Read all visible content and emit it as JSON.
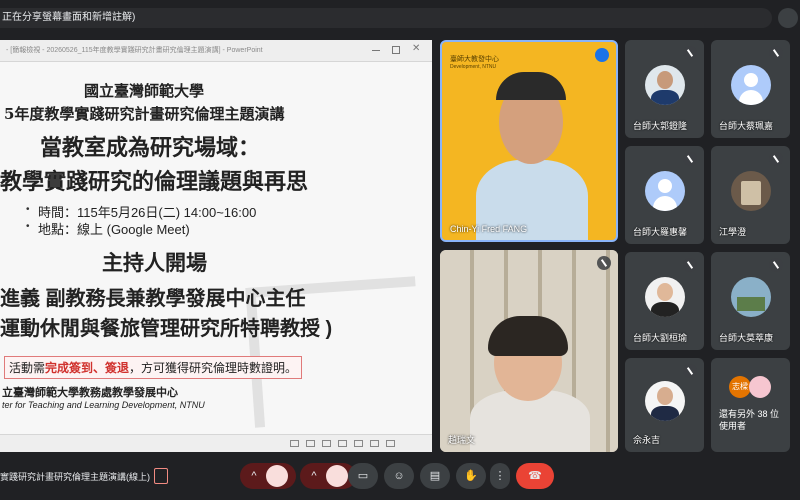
{
  "banner": {
    "text": "正在分享螢幕畫面和新增註解)"
  },
  "presentation": {
    "window_title": "- [簡報檢視 - 20260526_115年度教學實踐研究計畫研究倫理主題演講] - PowerPoint",
    "slide": {
      "university": "國立臺灣師範大學",
      "lecture": "5年度教學實踐研究計畫研究倫理主題演講",
      "topic_line1": "當教室成為研究場域：",
      "topic_line2": "教學實踐研究的倫理議題與再思",
      "time": "時間：115年5月26日(二) 14:00~16:00",
      "place": "地點：線上 (Google Meet)",
      "host_heading": "主持人開場",
      "host_line1": "進義 副教務長兼教學發展中心主任",
      "host_line2": "運動休閒與餐旅管理研究所特聘教授 )",
      "note_prefix": "活動需",
      "note_highlight": "完成簽到、簽退",
      "note_suffix": "，方可獲得研究倫理時數證明。",
      "org_zh": "立臺灣師範大學教務處教學發展中心",
      "org_en": "ter for Teaching and Learning Development, NTNU"
    }
  },
  "participants": {
    "speaker": {
      "name": "Chin-Yi Fred FANG",
      "logo_text": "臺師大教發中心",
      "logo_sub": "Development, NTNU"
    },
    "second": {
      "name": "趙瑞文"
    },
    "grid": [
      {
        "name": "台師大郭鐙隆"
      },
      {
        "name": "台師大蔡珮嘉"
      },
      {
        "name": "台師大羅惠馨"
      },
      {
        "name": "江學澄"
      },
      {
        "name": "台師大劉桓瑜"
      },
      {
        "name": "台師大莫萃康"
      },
      {
        "name": "佘永吉"
      },
      {
        "name": "還有另外 38 位使用者",
        "badge": "志樑"
      }
    ]
  },
  "meeting": {
    "title": "實踐研究計畫研究倫理主題演講(線上)"
  },
  "colors": {
    "accent_blue": "#6f8fcb",
    "danger": "#ea4335",
    "tile_yellow": "#f4b622"
  }
}
